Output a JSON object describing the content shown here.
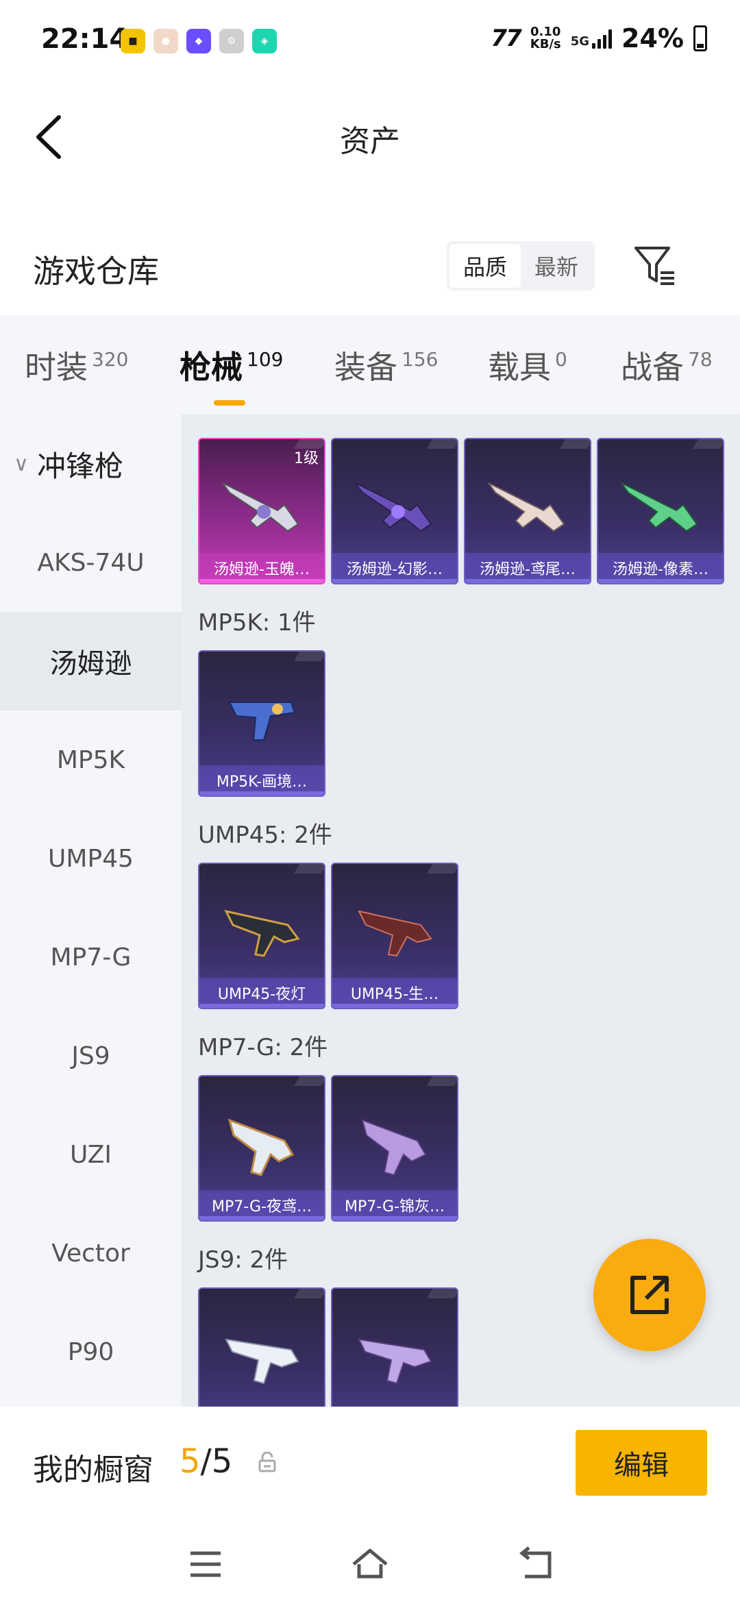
{
  "status_bar": {
    "time": "22:14",
    "speed_value": "0.10",
    "speed_unit": "KB/s",
    "network": "5G",
    "battery": "24%"
  },
  "header": {
    "title": "资产",
    "back_icon": "chevron-left-icon"
  },
  "warehouse": {
    "title": "游戏仓库",
    "sort_options": [
      "品质",
      "最新"
    ],
    "active_sort": "品质",
    "filter_icon": "filter-icon"
  },
  "tabs": [
    {
      "label": "时装",
      "count": "320"
    },
    {
      "label": "枪械",
      "count": "109",
      "active": true
    },
    {
      "label": "装备",
      "count": "156"
    },
    {
      "label": "载具",
      "count": "0"
    },
    {
      "label": "战备",
      "count": "78"
    }
  ],
  "sidebar": {
    "section": "冲锋枪",
    "items": [
      "AKS-74U",
      "汤姆逊",
      "MP5K",
      "UMP45",
      "MP7-G",
      "JS9",
      "UZI",
      "Vector",
      "P90"
    ],
    "active": "汤姆逊"
  },
  "groups": [
    {
      "label": "",
      "items": [
        {
          "name": "汤姆逊-玉魄…",
          "badge": "1级",
          "rarity": "pink"
        },
        {
          "name": "汤姆逊-幻影…",
          "rarity": "purple"
        },
        {
          "name": "汤姆逊-鸢尾…",
          "rarity": "purple"
        },
        {
          "name": "汤姆逊-像素…",
          "rarity": "purple"
        }
      ]
    },
    {
      "label": "MP5K: 1件",
      "items": [
        {
          "name": "MP5K-画境…",
          "rarity": "purple"
        }
      ]
    },
    {
      "label": "UMP45: 2件",
      "items": [
        {
          "name": "UMP45-夜灯",
          "rarity": "purple"
        },
        {
          "name": "UMP45-生…",
          "rarity": "purple"
        }
      ]
    },
    {
      "label": "MP7-G: 2件",
      "items": [
        {
          "name": "MP7-G-夜鸢…",
          "rarity": "purple"
        },
        {
          "name": "MP7-G-锦灰…",
          "rarity": "purple"
        }
      ]
    },
    {
      "label": "JS9: 2件",
      "items": [
        {
          "name": "",
          "rarity": "purple"
        },
        {
          "name": "",
          "rarity": "purple"
        }
      ]
    }
  ],
  "showcase": {
    "title": "我的橱窗",
    "current": "5",
    "total": "/5",
    "edit_label": "编辑"
  },
  "colors": {
    "accent": "#f9b400",
    "purple_card": "#3a2f66",
    "pink_card": "#c23cb5"
  }
}
